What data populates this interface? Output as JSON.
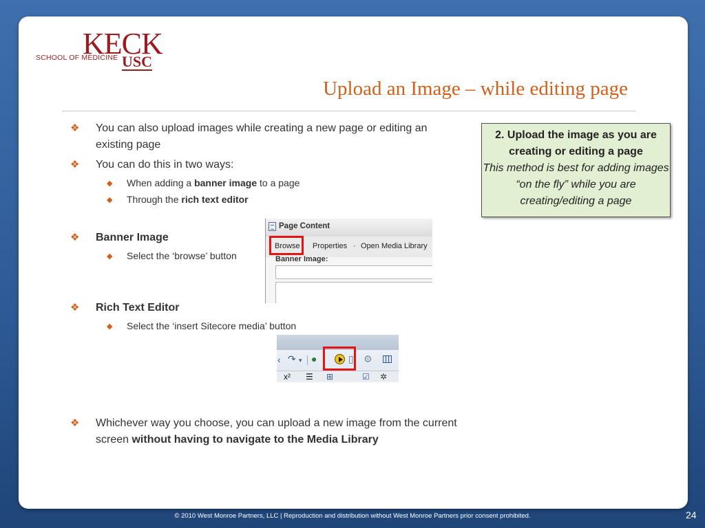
{
  "logo": {
    "keck": "KECK",
    "school": "SCHOOL OF MEDICINE",
    "usc": "USC"
  },
  "title": "Upload an Image – while editing page",
  "bullets": {
    "b1": "You can also upload images while creating a new page or editing an existing page",
    "b2": "You can do this in two ways:",
    "b2a_pre": "When adding a ",
    "b2a_bold": "banner image",
    "b2a_post": " to a page",
    "b2b_pre": "Through the ",
    "b2b_bold": "rich text editor",
    "banner_heading": "Banner Image",
    "banner_sub": "Select the ‘browse’ button",
    "rte_heading": "Rich Text Editor",
    "rte_sub": "Select the ‘insert Sitecore media’ button",
    "final_pre": "Whichever way you choose, you can upload a new image from the current screen ",
    "final_bold": "without having to navigate to the Media Library"
  },
  "callout": {
    "heading": "2. Upload the image as you are creating or editing a page",
    "body": "This method is best for adding images “on the fly” while you are creating/editing a page"
  },
  "screenshot_page_content": {
    "header": "Page Content",
    "links": [
      "Browse",
      "Properties",
      "·",
      "Open Media Library"
    ],
    "field_label": "Banner Image:"
  },
  "footer": "© 2010 West Monroe Partners, LLC  |  Reproduction and distribution without West Monroe Partners prior consent prohibited.",
  "page_number": "24",
  "colors": {
    "accent": "#d2601a",
    "brand": "#9b1b1f",
    "callout_bg": "#e3efd2",
    "highlight": "#e01616"
  }
}
